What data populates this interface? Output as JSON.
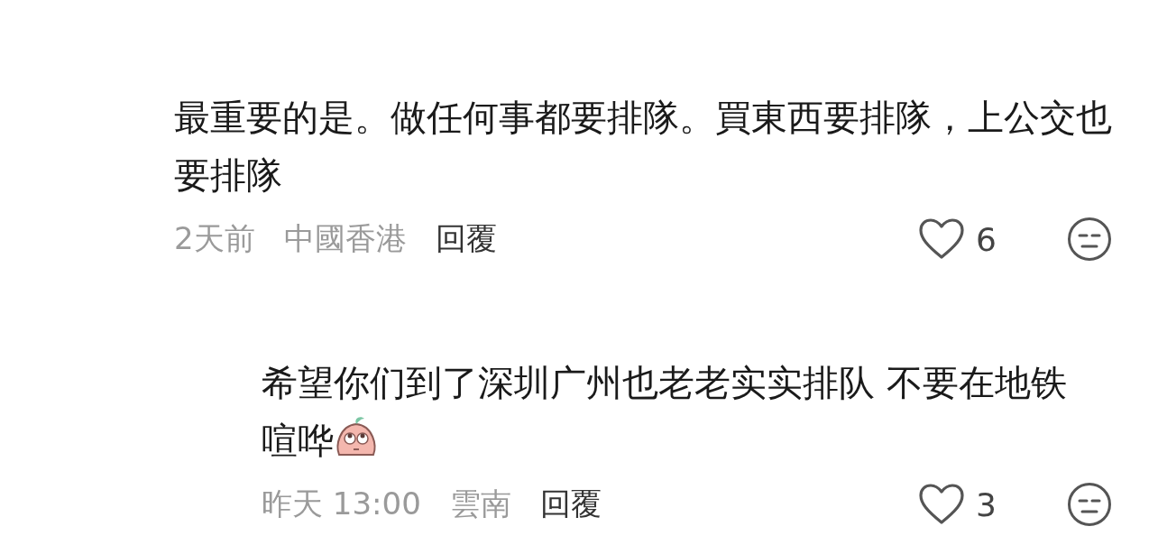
{
  "comments": [
    {
      "text": "最重要的是。做任何事都要排隊。買東西要排隊，上公交也要排隊",
      "time": "2天前",
      "location": "中國香港",
      "reply_label": "回覆",
      "likes": "6",
      "replies": [
        {
          "text": "希望你们到了深圳广州也老老实实排队 不要在地铁喧哗",
          "time": "昨天 13:00",
          "location": "雲南",
          "reply_label": "回覆",
          "likes": "3",
          "sticker": true
        }
      ]
    }
  ]
}
